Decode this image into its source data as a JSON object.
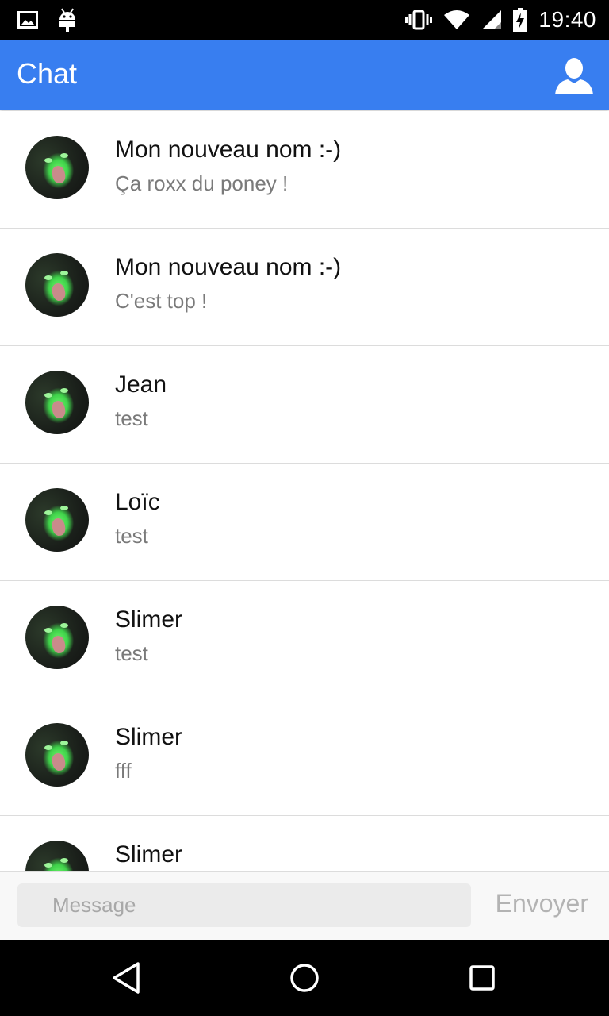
{
  "status_bar": {
    "time": "19:40",
    "left_icons": [
      "gallery-icon",
      "android-icon"
    ],
    "right_icons": [
      "vibrate-icon",
      "wifi-icon",
      "signal-icon",
      "battery-charging-icon"
    ]
  },
  "app_bar": {
    "title": "Chat",
    "profile_icon": "person-icon",
    "color": "#387ef0"
  },
  "messages": [
    {
      "name": "Mon nouveau nom :-)",
      "text": "Ça roxx du poney !"
    },
    {
      "name": "Mon nouveau nom :-)",
      "text": "C'est top !"
    },
    {
      "name": "Jean",
      "text": "test"
    },
    {
      "name": "Loïc",
      "text": "test"
    },
    {
      "name": "Slimer",
      "text": "test"
    },
    {
      "name": "Slimer",
      "text": "fff"
    },
    {
      "name": "Slimer",
      "text": ""
    }
  ],
  "composer": {
    "placeholder": "Message",
    "value": "",
    "send_label": "Envoyer"
  },
  "nav_bar": {
    "icons": [
      "back-icon",
      "home-icon",
      "recents-icon"
    ]
  }
}
